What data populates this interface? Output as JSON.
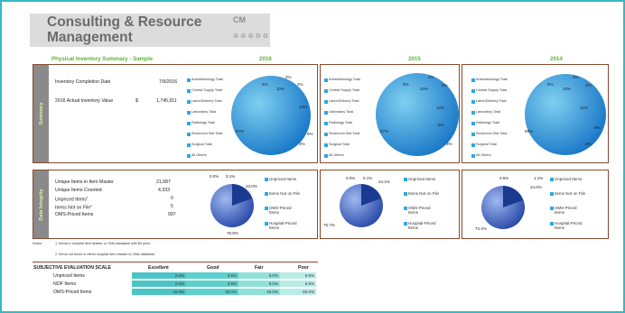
{
  "header": {
    "title_line1": "Consulting & Resource",
    "title_line2": "Management",
    "logo": "CM"
  },
  "summary": {
    "heading": "Physical Inventory Summary - Sample",
    "years": [
      "2016",
      "2015",
      "2014"
    ],
    "section_label": "Summary",
    "completion_label": "Inventory Completion Date",
    "completion_value": "7/9/2016",
    "inventory_label": "2016 Actual Inventory Value",
    "currency": "$",
    "inventory_value": "1,745,911",
    "legend": [
      "Anesthesiology Total",
      "Central Supply Total",
      "Labor/Delivery Total",
      "Laboratory Total",
      "Radiology Total",
      "Storeroom Dist Total",
      "Surgical Total",
      "All Others"
    ],
    "pies": [
      {
        "labels": [
          "2%",
          "2%",
          "13%",
          "8%",
          "3%",
          "57%",
          "5%",
          "10%"
        ]
      },
      {
        "labels": [
          "2%",
          "2%",
          "12%",
          "9%",
          "3%",
          "57%",
          "5%",
          "10%"
        ]
      },
      {
        "labels": [
          "2%",
          "2%",
          "12%",
          "9%",
          "2%",
          "58%",
          "5%",
          "10%"
        ]
      }
    ]
  },
  "integrity": {
    "section_label": "Data Integrity",
    "rows": [
      {
        "label": "Unique Items in Item Master",
        "value": "21,687"
      },
      {
        "label": "Unique Items Counted",
        "value": "4,333"
      },
      {
        "label": "Unpriced Items",
        "value": "0"
      },
      {
        "label": "Items Not on File",
        "value": "5"
      },
      {
        "label": "OMS-Priced Items",
        "value": "997"
      }
    ],
    "legend": [
      "Unpriced Items",
      "Items Not on File",
      "OMS-Priced Items",
      "Hospital-Priced Items"
    ],
    "pies": [
      {
        "l1": "0.0%",
        "l2": "0.1%",
        "l3": "23.0%",
        "l4": "76.9%"
      },
      {
        "l1": "0.0%",
        "l2": "0.1%",
        "l3": "24.1%",
        "l4": "75.7%"
      },
      {
        "l1": "0.5%",
        "l2": "1.1%",
        "l3": "24.0%",
        "l4": "74.4%"
      }
    ],
    "notes_label": "Notes:",
    "note1": "1. Items in hospital Item Master or OMs database with $0 price.",
    "note2": "2. Items not found in either hospital Item Master or OMs database.",
    "sup1": "1",
    "sup2": "2"
  },
  "scale": {
    "title": "SUBJECTIVE  EVALUATION  SCALE",
    "headers": [
      "Excellent",
      "Good",
      "Fair",
      "Poor"
    ],
    "rows": [
      {
        "label": "Unpriced Items",
        "values": [
          "2.0%",
          "3.5%",
          "5.0%",
          "6.5%"
        ]
      },
      {
        "label": "NOF Items",
        "values": [
          "2.0%",
          "3.5%",
          "5.0%",
          "6.5%"
        ]
      },
      {
        "label": "OMS-Priced Items",
        "values": [
          "15.0%",
          "30.0%",
          "45.0%",
          "60.0%"
        ]
      }
    ]
  },
  "colors": {
    "frame": "#39b8c2",
    "border": "#8a4a2e",
    "accent": "#5db038",
    "scale_excellent": "#4bc4c6",
    "scale_good": "#5cd0cc",
    "scale_fair": "#8fe0da",
    "scale_poor": "#b8ece6"
  }
}
